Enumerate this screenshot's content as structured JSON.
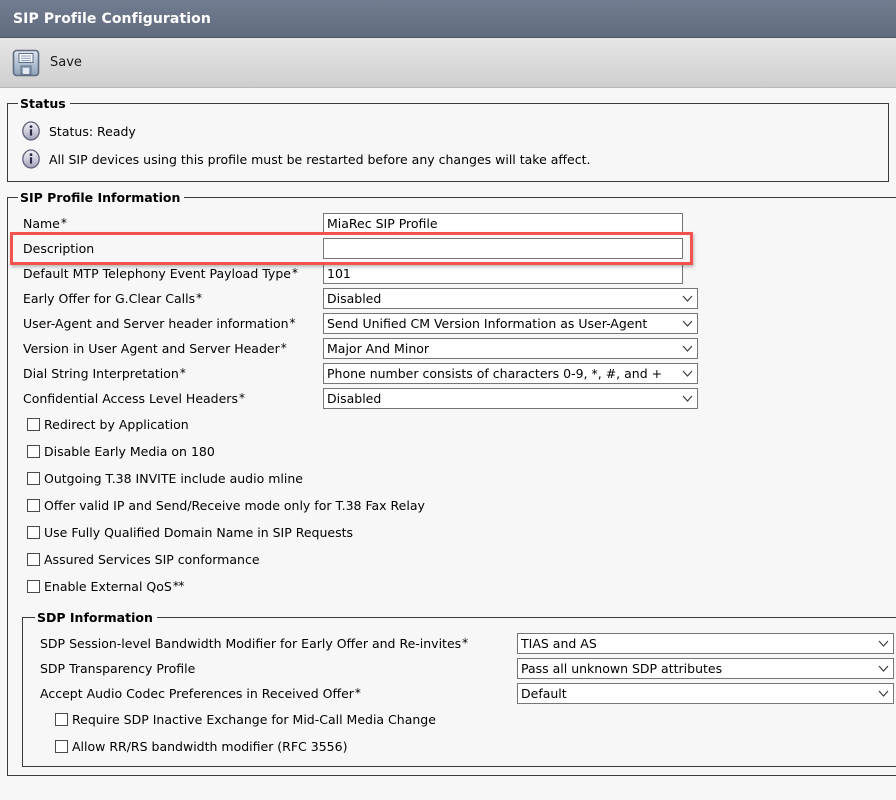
{
  "window": {
    "title": "SIP Profile Configuration"
  },
  "toolbar": {
    "save_label": "Save",
    "save_icon": "floppy-disk-save-icon"
  },
  "status": {
    "legend": "Status",
    "icon": "info-icon",
    "messages": [
      "Status: Ready",
      "All SIP devices using this profile must be restarted before any changes will take affect."
    ]
  },
  "sip_profile_information": {
    "legend": "SIP Profile Information",
    "highlight_color": "#f4524d",
    "fields": [
      {
        "label": "Name",
        "required": true,
        "type": "text",
        "value": "MiaRec SIP Profile",
        "highlighted": true
      },
      {
        "label": "Description",
        "required": false,
        "type": "text",
        "value": ""
      },
      {
        "label": "Default MTP Telephony Event Payload Type",
        "required": true,
        "type": "text",
        "value": "101"
      },
      {
        "label": "Early Offer for G.Clear Calls",
        "required": true,
        "type": "select",
        "value": "Disabled"
      },
      {
        "label": "User-Agent and Server header information",
        "required": true,
        "type": "select",
        "value": "Send Unified CM Version Information as User-Agent"
      },
      {
        "label": "Version in User Agent and Server Header",
        "required": true,
        "type": "select",
        "value": "Major And Minor"
      },
      {
        "label": "Dial String Interpretation",
        "required": true,
        "type": "select",
        "value": "Phone number consists of characters 0-9, *, #, and +"
      },
      {
        "label": "Confidential Access Level Headers",
        "required": true,
        "type": "select",
        "value": "Disabled"
      }
    ],
    "checkboxes": [
      {
        "label": "Redirect by Application",
        "checked": false
      },
      {
        "label": "Disable Early Media on 180",
        "checked": false
      },
      {
        "label": "Outgoing T.38 INVITE include audio mline",
        "checked": false
      },
      {
        "label": "Offer valid IP and Send/Receive mode only for T.38 Fax Relay",
        "checked": false
      },
      {
        "label": "Use Fully Qualified Domain Name in SIP Requests",
        "checked": false
      },
      {
        "label": "Assured Services SIP conformance",
        "checked": false
      },
      {
        "label": "Enable External QoS",
        "checked": false,
        "marker": "**"
      }
    ]
  },
  "sdp_information": {
    "legend": "SDP Information",
    "fields": [
      {
        "label": "SDP Session-level Bandwidth Modifier for Early Offer and Re-invites",
        "required": true,
        "type": "select",
        "value": "TIAS and AS"
      },
      {
        "label": "SDP Transparency Profile",
        "required": false,
        "type": "select",
        "value": "Pass all unknown SDP attributes"
      },
      {
        "label": "Accept Audio Codec Preferences in Received Offer",
        "required": true,
        "type": "select",
        "value": "Default"
      }
    ],
    "checkboxes": [
      {
        "label": "Require SDP Inactive Exchange for Mid-Call Media Change",
        "checked": false
      },
      {
        "label": "Allow RR/RS bandwidth modifier (RFC 3556)",
        "checked": false
      }
    ]
  }
}
